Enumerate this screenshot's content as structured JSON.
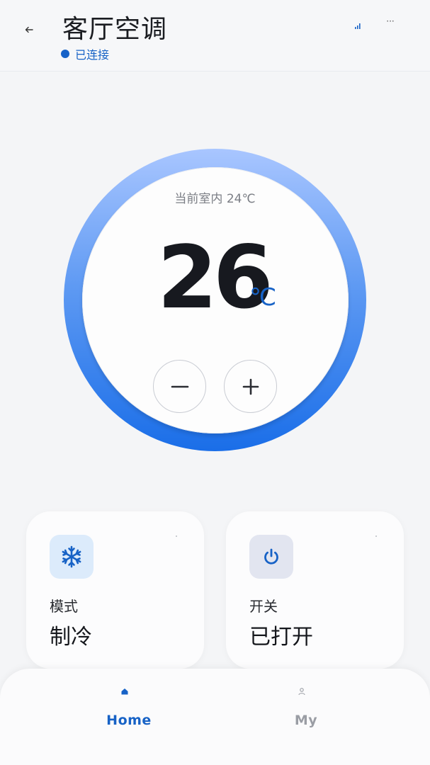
{
  "header": {
    "title": "客厅空调",
    "status_text": "已连接",
    "back_icon": "back-arrow-icon",
    "signal_icon": "signal-icon",
    "more_icon": "more-icon",
    "more_label": "···"
  },
  "dial": {
    "indoor_text": "当前室内 24℃",
    "target_temp": "26",
    "unit": "℃",
    "minus_icon": "minus-icon",
    "plus_icon": "plus-icon"
  },
  "cards": [
    {
      "label": "模式",
      "value": "制冷",
      "icon": "snowflake-icon"
    },
    {
      "label": "开关",
      "value": "已打开",
      "icon": "power-icon"
    }
  ],
  "nav": [
    {
      "label": "Home",
      "icon": "home-icon",
      "active": true
    },
    {
      "label": "My",
      "icon": "user-icon",
      "active": false
    }
  ],
  "colors": {
    "accent": "#1762c6",
    "ring_top": "#a9c6ff",
    "ring_bottom": "#1a6ee8",
    "background": "#f4f5f7"
  }
}
